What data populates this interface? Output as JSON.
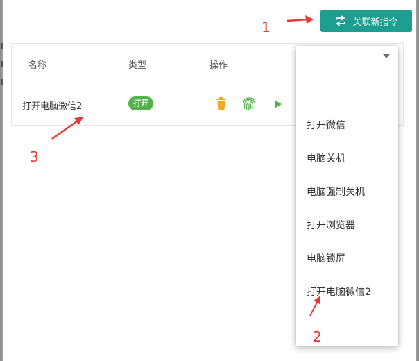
{
  "toolbar": {
    "link_button_label": "关联新指令",
    "link_button_icon": "repeat-arrows-icon",
    "accent_color": "#1e9e8f"
  },
  "table": {
    "columns": [
      "名称",
      "类型",
      "操作"
    ],
    "rows": [
      {
        "name": "打开电脑微信2",
        "type_tag": "打开",
        "type_tag_color": "#52b24a",
        "actions": [
          {
            "icon": "trash-icon",
            "color": "#f5a623"
          },
          {
            "icon": "fingerprint-icon",
            "color": "#52b24a"
          },
          {
            "icon": "play-icon",
            "color": "#52b24a"
          }
        ]
      }
    ]
  },
  "dropdown": {
    "items": [
      "打开微信",
      "电脑关机",
      "电脑强制关机",
      "打开浏览器",
      "电脑锁屏",
      "打开电脑微信2"
    ]
  },
  "annotations": {
    "label_1": "1",
    "label_2": "2",
    "label_3": "3",
    "color": "#e53935"
  }
}
